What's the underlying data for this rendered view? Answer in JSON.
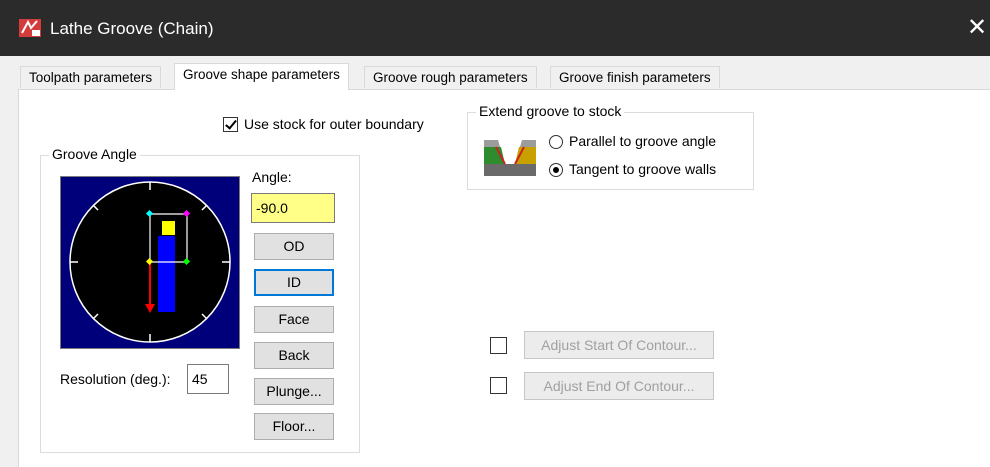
{
  "window": {
    "title": "Lathe Groove (Chain)",
    "close_glyph": "✕"
  },
  "tabs": [
    {
      "label": "Toolpath parameters"
    },
    {
      "label": "Groove shape parameters",
      "active": true
    },
    {
      "label": "Groove rough parameters"
    },
    {
      "label": "Groove finish parameters"
    }
  ],
  "use_stock": {
    "label": "Use stock for outer boundary",
    "checked": true
  },
  "groove_angle": {
    "group_title": "Groove Angle",
    "angle_label": "Angle:",
    "angle_value": "-90.0",
    "buttons": [
      "OD",
      "ID",
      "Face",
      "Back",
      "Plunge...",
      "Floor..."
    ],
    "resolution_label": "Resolution (deg.):",
    "resolution_value": "45"
  },
  "extend_groove": {
    "group_title": "Extend groove to stock",
    "options": [
      {
        "label": "Parallel to groove angle",
        "selected": false
      },
      {
        "label": "Tangent to groove walls",
        "selected": true
      }
    ]
  },
  "adjust": {
    "start_label": "Adjust Start Of Contour...",
    "end_label": "Adjust End Of Contour...",
    "start_checked": false,
    "end_checked": false
  },
  "colors": {
    "dial_bg": "#00007a",
    "groove_tool": "#0000ff",
    "groove_tip": "#ffff00",
    "angle_arrow": "#ff0000",
    "input_highlight": "#ffff88",
    "focus_border": "#0078d7"
  }
}
